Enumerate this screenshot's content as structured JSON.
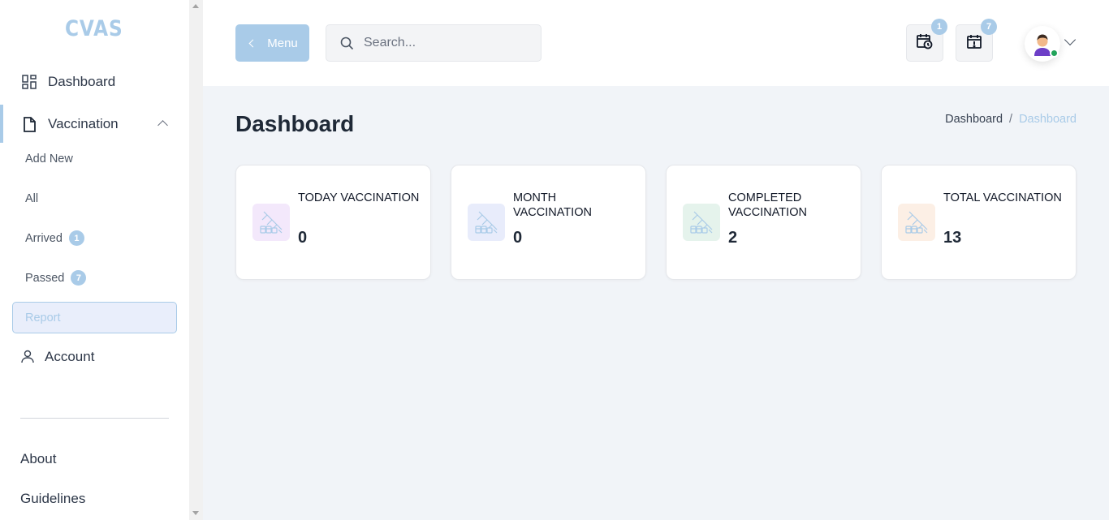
{
  "app": {
    "logo": "CVAS"
  },
  "sidebar": {
    "dashboard": "Dashboard",
    "vaccination": "Vaccination",
    "sub": {
      "add_new": "Add New",
      "all": "All",
      "arrived": "Arrived",
      "arrived_count": "1",
      "passed": "Passed",
      "passed_count": "7",
      "report": "Report"
    },
    "account": "Account",
    "about": "About",
    "guidelines": "Guidelines"
  },
  "header": {
    "menu_label": "Menu",
    "search_placeholder": "Search...",
    "notif_calendar_count": "1",
    "notif_alert_count": "7"
  },
  "page": {
    "title": "Dashboard",
    "breadcrumb": [
      "Dashboard",
      "/",
      "Dashboard"
    ]
  },
  "cards": [
    {
      "title": "TODAY VACCINATION",
      "value": "0",
      "tint": "#f3e8fb"
    },
    {
      "title": "MONTH VACCINATION",
      "value": "0",
      "tint": "#e8ecfb"
    },
    {
      "title": "COMPLETED VACCINATION",
      "value": "2",
      "tint": "#e5f3ec"
    },
    {
      "title": "TOTAL VACCINATION",
      "value": "13",
      "tint": "#fcefe5"
    }
  ],
  "colors": {
    "accent": "#a9cbe8",
    "online": "#22a35a"
  }
}
